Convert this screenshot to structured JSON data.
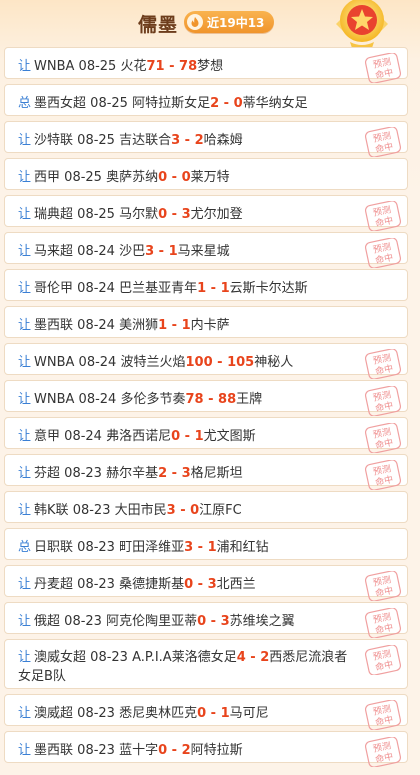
{
  "header": {
    "title": "儒墨",
    "record": "近19中13"
  },
  "stamp_text": [
    "预测",
    "命中"
  ],
  "colors": {
    "accent": "#e8441c",
    "tag": "#3a7fd4",
    "badge": "#f0942b",
    "title": "#6d3d1c"
  },
  "predictions": [
    {
      "tag": "让",
      "league": "WNBA",
      "date": "08-25",
      "home": "火花",
      "home_score": "71",
      "sep": " - ",
      "away_score": "78",
      "away": "梦想",
      "hit": true
    },
    {
      "tag": "总",
      "league": "墨西女超",
      "date": "08-25",
      "home": "阿特拉斯女足",
      "home_score": "2",
      "sep": " - ",
      "away_score": "0",
      "away": "蒂华纳女足",
      "hit": false
    },
    {
      "tag": "让",
      "league": "沙特联",
      "date": "08-25",
      "home": "吉达联合",
      "home_score": "3",
      "sep": " - ",
      "away_score": "2",
      "away": "哈森姆",
      "hit": true
    },
    {
      "tag": "让",
      "league": "西甲",
      "date": "08-25",
      "home": "奥萨苏纳",
      "home_score": "0",
      "sep": " - ",
      "away_score": "0",
      "away": "莱万特",
      "hit": false
    },
    {
      "tag": "让",
      "league": "瑞典超",
      "date": "08-25",
      "home": "马尔默",
      "home_score": "0",
      "sep": " - ",
      "away_score": "3",
      "away": "尤尔加登",
      "hit": true
    },
    {
      "tag": "让",
      "league": "马来超",
      "date": "08-24",
      "home": "沙巴",
      "home_score": "3",
      "sep": " - ",
      "away_score": "1",
      "away": "马来星城",
      "hit": true
    },
    {
      "tag": "让",
      "league": "哥伦甲",
      "date": "08-24",
      "home": "巴兰基亚青年",
      "home_score": "1",
      "sep": " - ",
      "away_score": "1",
      "away": "云斯卡尔达斯",
      "hit": false
    },
    {
      "tag": "让",
      "league": "墨西联",
      "date": "08-24",
      "home": "美洲狮",
      "home_score": "1",
      "sep": " - ",
      "away_score": "1",
      "away": "内卡萨",
      "hit": false
    },
    {
      "tag": "让",
      "league": "WNBA",
      "date": "08-24",
      "home": "波特兰火焰",
      "home_score": "100",
      "sep": " - ",
      "away_score": "105",
      "away": "神秘人",
      "hit": true
    },
    {
      "tag": "让",
      "league": "WNBA",
      "date": "08-24",
      "home": "多伦多节奏",
      "home_score": "78",
      "sep": " - ",
      "away_score": "88",
      "away": "王牌",
      "hit": true
    },
    {
      "tag": "让",
      "league": "意甲",
      "date": "08-24",
      "home": "弗洛西诺尼",
      "home_score": "0",
      "sep": " - ",
      "away_score": "1",
      "away": "尤文图斯",
      "hit": true
    },
    {
      "tag": "让",
      "league": "芬超",
      "date": "08-23",
      "home": "赫尔辛基",
      "home_score": "2",
      "sep": " - ",
      "away_score": "3",
      "away": "格尼斯坦",
      "hit": true
    },
    {
      "tag": "让",
      "league": "韩K联",
      "date": "08-23",
      "home": "大田市民",
      "home_score": "3",
      "sep": " - ",
      "away_score": "0",
      "away": "江原FC",
      "hit": false
    },
    {
      "tag": "总",
      "league": "日职联",
      "date": "08-23",
      "home": "町田泽维亚",
      "home_score": "3",
      "sep": " - ",
      "away_score": "1",
      "away": "浦和红钻",
      "hit": false
    },
    {
      "tag": "让",
      "league": "丹麦超",
      "date": "08-23",
      "home": "桑德捷斯基",
      "home_score": "0",
      "sep": " - ",
      "away_score": "3",
      "away": "北西兰",
      "hit": true
    },
    {
      "tag": "让",
      "league": "俄超",
      "date": "08-23",
      "home": "阿克伦陶里亚蒂",
      "home_score": "0",
      "sep": " - ",
      "away_score": "3",
      "away": "苏维埃之翼",
      "hit": true
    },
    {
      "tag": "让",
      "league": "澳威女超",
      "date": "08-23",
      "home": "A.P.I.A莱洛德女足",
      "home_score": "4",
      "sep": " - ",
      "away_score": "2",
      "away": "西悉尼流浪者女足B队",
      "hit": true
    },
    {
      "tag": "让",
      "league": "澳威超",
      "date": "08-23",
      "home": "悉尼奥林匹克",
      "home_score": "0",
      "sep": " - ",
      "away_score": "1",
      "away": "马可尼",
      "hit": true
    },
    {
      "tag": "让",
      "league": "墨西联",
      "date": "08-23",
      "home": "蓝十字",
      "home_score": "0",
      "sep": " - ",
      "away_score": "2",
      "away": "阿特拉斯",
      "hit": true
    }
  ]
}
